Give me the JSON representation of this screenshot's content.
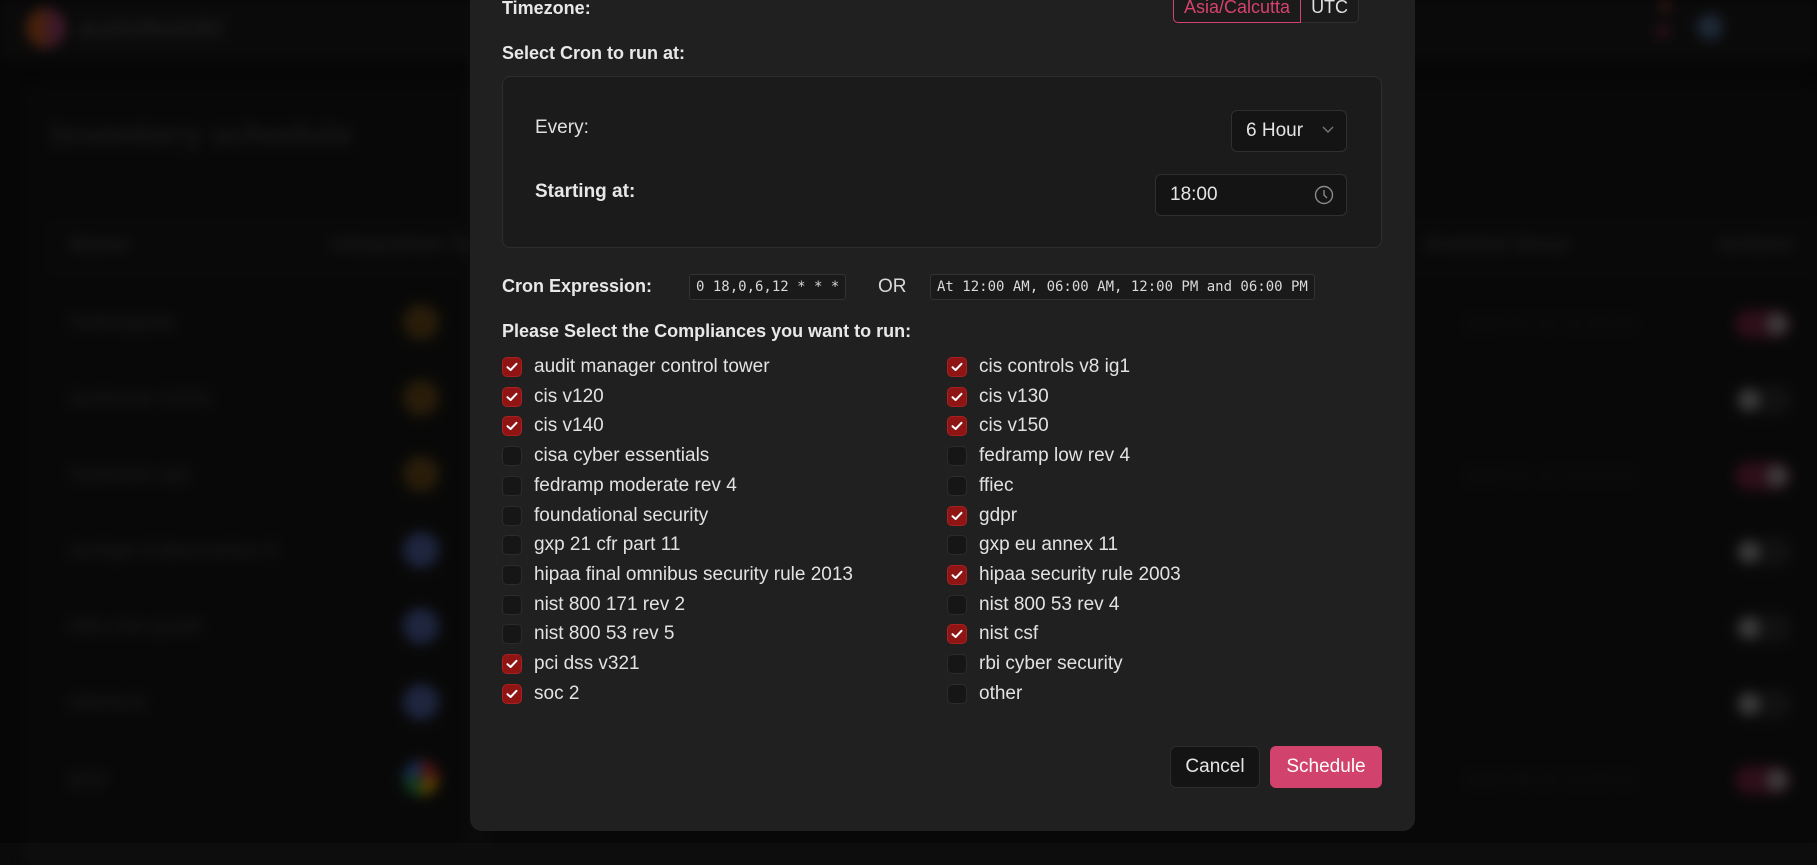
{
  "background": {
    "app_name": "autobotAI",
    "page_title": "Inventory schedule",
    "table_headers": [
      "Name",
      "Integration Type",
      "Enabled Since",
      "Actions"
    ],
    "rows": [
      {
        "name": "fudongate",
        "integration": "aws",
        "enabled_since": "2024-07-15 11:20:00",
        "enabled": true
      },
      {
        "name": "testnew-1333",
        "integration": "aws",
        "enabled_since": "",
        "enabled": false
      },
      {
        "name": "testnew-api",
        "integration": "aws",
        "enabled_since": "2024-11-12 10:22:31",
        "enabled": true
      },
      {
        "name": "testgo-kubernetes-1",
        "integration": "kubernetes",
        "enabled_since": "",
        "enabled": false
      },
      {
        "name": "k8s-vm-yuu9",
        "integration": "kubernetes",
        "enabled_since": "",
        "enabled": false
      },
      {
        "name": "k8stest",
        "integration": "kubernetes",
        "enabled_since": "",
        "enabled": false
      },
      {
        "name": "gcp",
        "integration": "gcp",
        "enabled_since": "2024-06-24 10:20:31",
        "enabled": true
      }
    ]
  },
  "modal": {
    "timezone_label": "Timezone:",
    "timezone_options": [
      {
        "label": "Asia/Calcutta",
        "selected": true
      },
      {
        "label": "UTC",
        "selected": false
      }
    ],
    "cron_section_label": "Select Cron to run at:",
    "every_label": "Every:",
    "every_value": "6 Hour",
    "starting_at_label": "Starting at:",
    "starting_at_value": "18:00",
    "cron_expression_label": "Cron Expression:",
    "cron_expression": "0 18,0,6,12 * * *",
    "or_label": "OR",
    "cron_description": "At 12:00 AM, 06:00 AM, 12:00 PM and 06:00 PM",
    "compliances_label": "Please Select the Compliances you want to run:",
    "compliances": [
      {
        "label": "audit manager control tower",
        "checked": true
      },
      {
        "label": "cis controls v8 ig1",
        "checked": true
      },
      {
        "label": "cis v120",
        "checked": true
      },
      {
        "label": "cis v130",
        "checked": true
      },
      {
        "label": "cis v140",
        "checked": true
      },
      {
        "label": "cis v150",
        "checked": true
      },
      {
        "label": "cisa cyber essentials",
        "checked": false
      },
      {
        "label": "fedramp low rev 4",
        "checked": false
      },
      {
        "label": "fedramp moderate rev 4",
        "checked": false
      },
      {
        "label": "ffiec",
        "checked": false
      },
      {
        "label": "foundational security",
        "checked": false
      },
      {
        "label": "gdpr",
        "checked": true
      },
      {
        "label": "gxp 21 cfr part 11",
        "checked": false
      },
      {
        "label": "gxp eu annex 11",
        "checked": false
      },
      {
        "label": "hipaa final omnibus security rule 2013",
        "checked": false
      },
      {
        "label": "hipaa security rule 2003",
        "checked": true
      },
      {
        "label": "nist 800 171 rev 2",
        "checked": false
      },
      {
        "label": "nist 800 53 rev 4",
        "checked": false
      },
      {
        "label": "nist 800 53 rev 5",
        "checked": false
      },
      {
        "label": "nist csf",
        "checked": true
      },
      {
        "label": "pci dss v321",
        "checked": true
      },
      {
        "label": "rbi cyber security",
        "checked": false
      },
      {
        "label": "soc 2",
        "checked": true
      },
      {
        "label": "other",
        "checked": false
      }
    ],
    "cancel_label": "Cancel",
    "schedule_label": "Schedule"
  },
  "colors": {
    "accent": "#d1436c",
    "checkbox_checked": "#8f1414",
    "modal_bg": "#202020"
  }
}
